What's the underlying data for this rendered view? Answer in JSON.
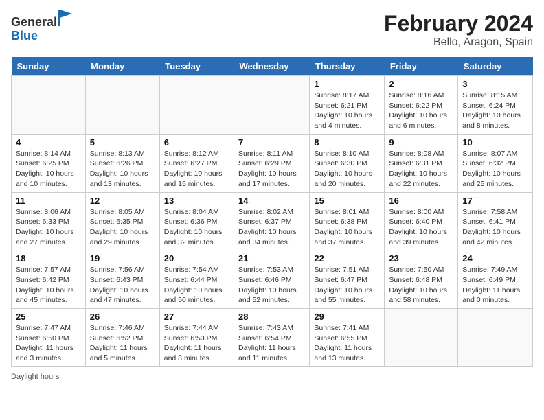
{
  "header": {
    "logo_line1": "General",
    "logo_line2": "Blue",
    "month_year": "February 2024",
    "location": "Bello, Aragon, Spain"
  },
  "days_of_week": [
    "Sunday",
    "Monday",
    "Tuesday",
    "Wednesday",
    "Thursday",
    "Friday",
    "Saturday"
  ],
  "weeks": [
    [
      {
        "num": "",
        "info": ""
      },
      {
        "num": "",
        "info": ""
      },
      {
        "num": "",
        "info": ""
      },
      {
        "num": "",
        "info": ""
      },
      {
        "num": "1",
        "info": "Sunrise: 8:17 AM\nSunset: 6:21 PM\nDaylight: 10 hours\nand 4 minutes."
      },
      {
        "num": "2",
        "info": "Sunrise: 8:16 AM\nSunset: 6:22 PM\nDaylight: 10 hours\nand 6 minutes."
      },
      {
        "num": "3",
        "info": "Sunrise: 8:15 AM\nSunset: 6:24 PM\nDaylight: 10 hours\nand 8 minutes."
      }
    ],
    [
      {
        "num": "4",
        "info": "Sunrise: 8:14 AM\nSunset: 6:25 PM\nDaylight: 10 hours\nand 10 minutes."
      },
      {
        "num": "5",
        "info": "Sunrise: 8:13 AM\nSunset: 6:26 PM\nDaylight: 10 hours\nand 13 minutes."
      },
      {
        "num": "6",
        "info": "Sunrise: 8:12 AM\nSunset: 6:27 PM\nDaylight: 10 hours\nand 15 minutes."
      },
      {
        "num": "7",
        "info": "Sunrise: 8:11 AM\nSunset: 6:29 PM\nDaylight: 10 hours\nand 17 minutes."
      },
      {
        "num": "8",
        "info": "Sunrise: 8:10 AM\nSunset: 6:30 PM\nDaylight: 10 hours\nand 20 minutes."
      },
      {
        "num": "9",
        "info": "Sunrise: 8:08 AM\nSunset: 6:31 PM\nDaylight: 10 hours\nand 22 minutes."
      },
      {
        "num": "10",
        "info": "Sunrise: 8:07 AM\nSunset: 6:32 PM\nDaylight: 10 hours\nand 25 minutes."
      }
    ],
    [
      {
        "num": "11",
        "info": "Sunrise: 8:06 AM\nSunset: 6:33 PM\nDaylight: 10 hours\nand 27 minutes."
      },
      {
        "num": "12",
        "info": "Sunrise: 8:05 AM\nSunset: 6:35 PM\nDaylight: 10 hours\nand 29 minutes."
      },
      {
        "num": "13",
        "info": "Sunrise: 8:04 AM\nSunset: 6:36 PM\nDaylight: 10 hours\nand 32 minutes."
      },
      {
        "num": "14",
        "info": "Sunrise: 8:02 AM\nSunset: 6:37 PM\nDaylight: 10 hours\nand 34 minutes."
      },
      {
        "num": "15",
        "info": "Sunrise: 8:01 AM\nSunset: 6:38 PM\nDaylight: 10 hours\nand 37 minutes."
      },
      {
        "num": "16",
        "info": "Sunrise: 8:00 AM\nSunset: 6:40 PM\nDaylight: 10 hours\nand 39 minutes."
      },
      {
        "num": "17",
        "info": "Sunrise: 7:58 AM\nSunset: 6:41 PM\nDaylight: 10 hours\nand 42 minutes."
      }
    ],
    [
      {
        "num": "18",
        "info": "Sunrise: 7:57 AM\nSunset: 6:42 PM\nDaylight: 10 hours\nand 45 minutes."
      },
      {
        "num": "19",
        "info": "Sunrise: 7:56 AM\nSunset: 6:43 PM\nDaylight: 10 hours\nand 47 minutes."
      },
      {
        "num": "20",
        "info": "Sunrise: 7:54 AM\nSunset: 6:44 PM\nDaylight: 10 hours\nand 50 minutes."
      },
      {
        "num": "21",
        "info": "Sunrise: 7:53 AM\nSunset: 6:46 PM\nDaylight: 10 hours\nand 52 minutes."
      },
      {
        "num": "22",
        "info": "Sunrise: 7:51 AM\nSunset: 6:47 PM\nDaylight: 10 hours\nand 55 minutes."
      },
      {
        "num": "23",
        "info": "Sunrise: 7:50 AM\nSunset: 6:48 PM\nDaylight: 10 hours\nand 58 minutes."
      },
      {
        "num": "24",
        "info": "Sunrise: 7:49 AM\nSunset: 6:49 PM\nDaylight: 11 hours\nand 0 minutes."
      }
    ],
    [
      {
        "num": "25",
        "info": "Sunrise: 7:47 AM\nSunset: 6:50 PM\nDaylight: 11 hours\nand 3 minutes."
      },
      {
        "num": "26",
        "info": "Sunrise: 7:46 AM\nSunset: 6:52 PM\nDaylight: 11 hours\nand 5 minutes."
      },
      {
        "num": "27",
        "info": "Sunrise: 7:44 AM\nSunset: 6:53 PM\nDaylight: 11 hours\nand 8 minutes."
      },
      {
        "num": "28",
        "info": "Sunrise: 7:43 AM\nSunset: 6:54 PM\nDaylight: 11 hours\nand 11 minutes."
      },
      {
        "num": "29",
        "info": "Sunrise: 7:41 AM\nSunset: 6:55 PM\nDaylight: 11 hours\nand 13 minutes."
      },
      {
        "num": "",
        "info": ""
      },
      {
        "num": "",
        "info": ""
      }
    ]
  ],
  "footer": {
    "text": "Daylight hours"
  }
}
